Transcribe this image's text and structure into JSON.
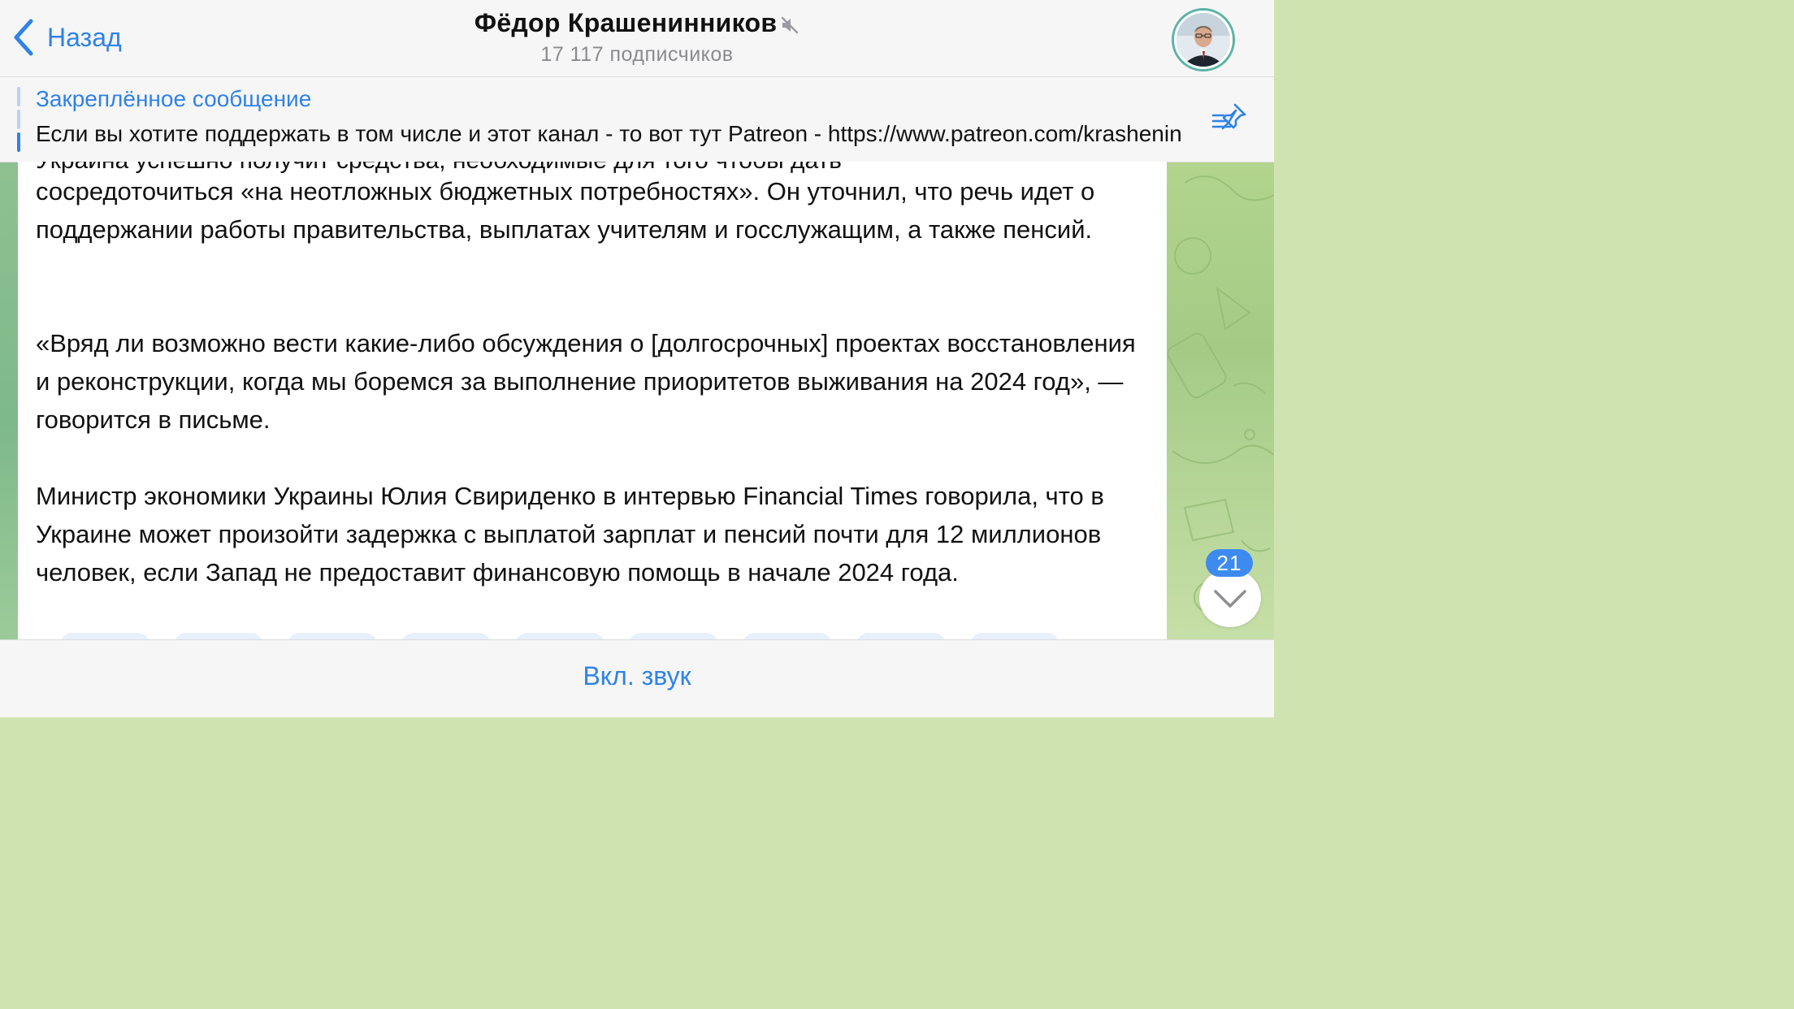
{
  "header": {
    "back_label": "Назад",
    "title": "Фёдор Крашенинников",
    "subtitle": "17 117 подписчиков",
    "muted_icon": "speaker-muted-icon",
    "avatar_icon": "channel-avatar"
  },
  "pinned": {
    "label": "Закреплённое сообщение",
    "text": "Если вы хотите поддержать в том числе и этот канал - то вот тут Patreon - https://www.patreon.com/krashenin",
    "list_icon": "pinned-list-icon"
  },
  "message": {
    "clipped_line": "Украина успешно получит средства, необходимые для того чтобы дать",
    "paragraphs": [
      "сосредоточиться «на неотложных бюджетных потребностях». Он уточнил, что речь идет о поддержании работы правительства, выплатах учителям и госслужащим, а также пенсий.",
      "«Вряд ли возможно вести какие-либо обсуждения о [долгосрочных] проектах восстановления и реконструкции, когда мы боремся за выполнение приоритетов выживания на 2024 год», — говорится в письме.",
      "Министр экономики Украины Юлия Свириденко в интервью Financial Times говорила, что в Украине может произойти задержка с выплатой зарплат и пенсий почти для 12 миллионов человек, если Запад не предоставит финансовую помощь в начале 2024 года."
    ]
  },
  "scroll_down": {
    "unread_count": "21",
    "icon": "chevron-down-icon"
  },
  "bottom": {
    "unmute_label": "Вкл. звук"
  },
  "colors": {
    "accent": "#2f82e8",
    "badge": "#3d8bf1",
    "bar_background": "#f6f6f6"
  }
}
